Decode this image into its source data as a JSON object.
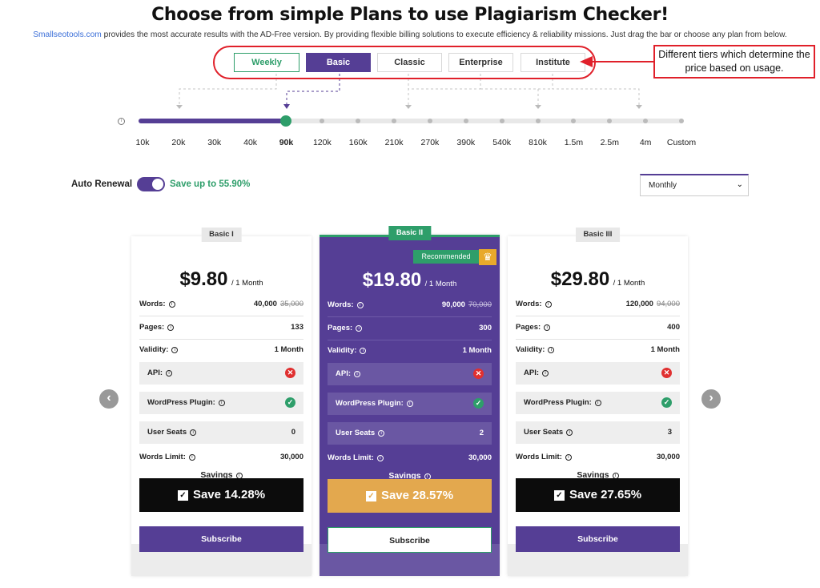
{
  "header": {
    "title": "Choose from simple Plans to use Plagiarism Checker!",
    "subtitle_link": "Smallseotools.com",
    "subtitle_text": " provides the most accurate results with the AD-Free version. By providing flexible billing solutions to execute efficiency & reliability missions. Just drag the bar or choose any plan from below."
  },
  "tabs": [
    {
      "label": "Weekly"
    },
    {
      "label": "Basic"
    },
    {
      "label": "Classic"
    },
    {
      "label": "Enterprise"
    },
    {
      "label": "Institute"
    }
  ],
  "active_tab": "Basic",
  "annotation": {
    "callout": "Different tiers which determine the price based on usage.",
    "color": "#e0202a"
  },
  "slider": {
    "info_icon": "info-icon",
    "steps": [
      "10k",
      "20k",
      "30k",
      "40k",
      "90k",
      "120k",
      "160k",
      "210k",
      "270k",
      "390k",
      "540k",
      "810k",
      "1.5m",
      "2.5m",
      "4m",
      "Custom"
    ],
    "selected": "90k",
    "selected_index": 4
  },
  "renewal": {
    "label": "Auto Renewal",
    "enabled": true,
    "savings_text": "Save up to 55.90%"
  },
  "billing": {
    "selected": "Monthly"
  },
  "nav": {
    "prev_icon": "chevron-left-icon",
    "next_icon": "chevron-right-icon"
  },
  "cards": [
    {
      "name": "Basic I",
      "price": "$9.80",
      "period": "/ 1 Month",
      "words_label": "Words:",
      "words": "40,000",
      "words_old": "35,000",
      "pages_label": "Pages:",
      "pages": "133",
      "validity_label": "Validity:",
      "validity": "1 Month",
      "api_label": "API:",
      "api": false,
      "wp_label": "WordPress Plugin:",
      "wp": true,
      "seats_label": "User Seats",
      "seats": "0",
      "limit_label": "Words Limit:",
      "limit": "30,000",
      "savings_label": "Savings",
      "savings": "Save 14.28%",
      "subscribe": "Subscribe"
    },
    {
      "name": "Basic II",
      "recommended": "Recommended",
      "price": "$19.80",
      "period": "/ 1 Month",
      "words_label": "Words:",
      "words": "90,000",
      "words_old": "70,000",
      "pages_label": "Pages:",
      "pages": "300",
      "validity_label": "Validity:",
      "validity": "1 Month",
      "api_label": "API:",
      "api": false,
      "wp_label": "WordPress Plugin:",
      "wp": true,
      "seats_label": "User Seats",
      "seats": "2",
      "limit_label": "Words Limit:",
      "limit": "30,000",
      "savings_label": "Savings",
      "savings": "Save 28.57%",
      "subscribe": "Subscribe"
    },
    {
      "name": "Basic III",
      "price": "$29.80",
      "period": "/ 1 Month",
      "words_label": "Words:",
      "words": "120,000",
      "words_old": "94,000",
      "pages_label": "Pages:",
      "pages": "400",
      "validity_label": "Validity:",
      "validity": "1 Month",
      "api_label": "API:",
      "api": false,
      "wp_label": "WordPress Plugin:",
      "wp": true,
      "seats_label": "User Seats",
      "seats": "3",
      "limit_label": "Words Limit:",
      "limit": "30,000",
      "savings_label": "Savings",
      "savings": "Save 27.65%",
      "subscribe": "Subscribe"
    }
  ],
  "colors": {
    "brand": "#553e95",
    "accent_green": "#2e9e6a",
    "highlight_gold": "#e3a84e",
    "error_red": "#e03030"
  }
}
